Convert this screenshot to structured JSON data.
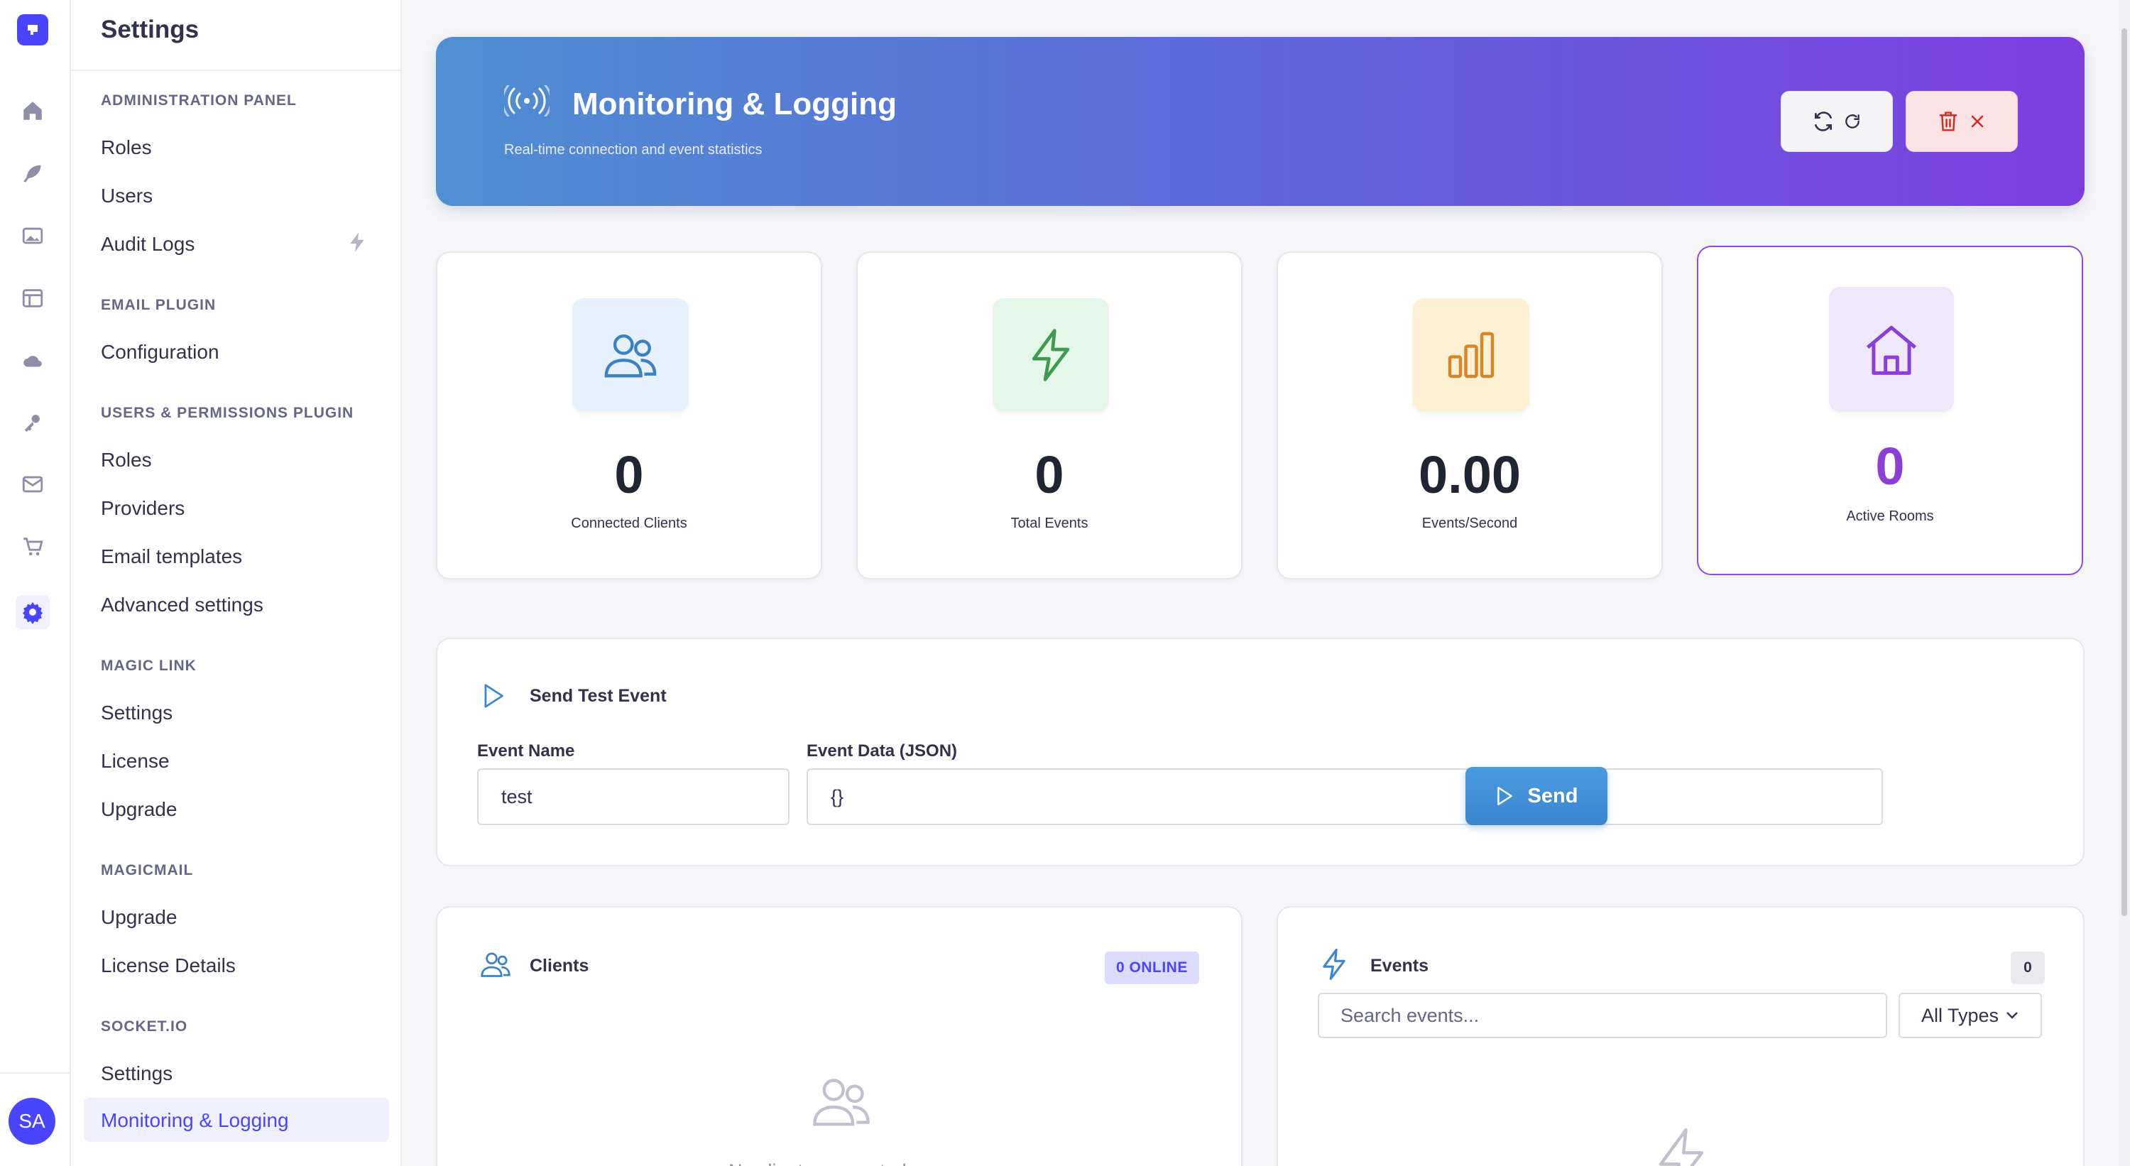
{
  "subnav": {
    "title": "Settings",
    "sections": [
      {
        "label": "Administration Panel",
        "items": [
          "Roles",
          "Users",
          "Audit Logs"
        ]
      },
      {
        "label": "Email Plugin",
        "items": [
          "Configuration"
        ]
      },
      {
        "label": "Users & Permissions Plugin",
        "items": [
          "Roles",
          "Providers",
          "Email templates",
          "Advanced settings"
        ]
      },
      {
        "label": "Magic Link",
        "items": [
          "Settings",
          "License",
          "Upgrade"
        ]
      },
      {
        "label": "MagicMail",
        "items": [
          "Upgrade",
          "License Details"
        ]
      },
      {
        "label": "Socket.IO",
        "items": [
          "Settings",
          "Monitoring & Logging"
        ]
      }
    ]
  },
  "user": {
    "initials": "SA"
  },
  "banner": {
    "title": "Monitoring & Logging",
    "subtitle": "Real-time connection and event statistics"
  },
  "stats": [
    {
      "value": "0",
      "label": "Connected Clients",
      "icon": "users-icon",
      "color": "#3b82c4",
      "bg": "#e6f1fb"
    },
    {
      "value": "0",
      "label": "Total Events",
      "icon": "bolt-icon",
      "color": "#3f9b4f",
      "bg": "#e5f7e8"
    },
    {
      "value": "0.00",
      "label": "Events/Second",
      "icon": "bar-chart-icon",
      "color": "#d3862a",
      "bg": "#fdf1d3"
    },
    {
      "value": "0",
      "label": "Active Rooms",
      "icon": "home-icon",
      "color": "#8b3fd6",
      "bg": "#efe8fb"
    }
  ],
  "test_event": {
    "title": "Send Test Event",
    "event_name_label": "Event Name",
    "event_name_value": "test",
    "event_data_label": "Event Data (JSON)",
    "event_data_value": "{}",
    "send_label": "Send"
  },
  "clients": {
    "title": "Clients",
    "badge": "0 ONLINE",
    "empty": "No clients connected"
  },
  "events": {
    "title": "Events",
    "count": "0",
    "search_placeholder": "Search events...",
    "filter_selected": "All Types"
  }
}
